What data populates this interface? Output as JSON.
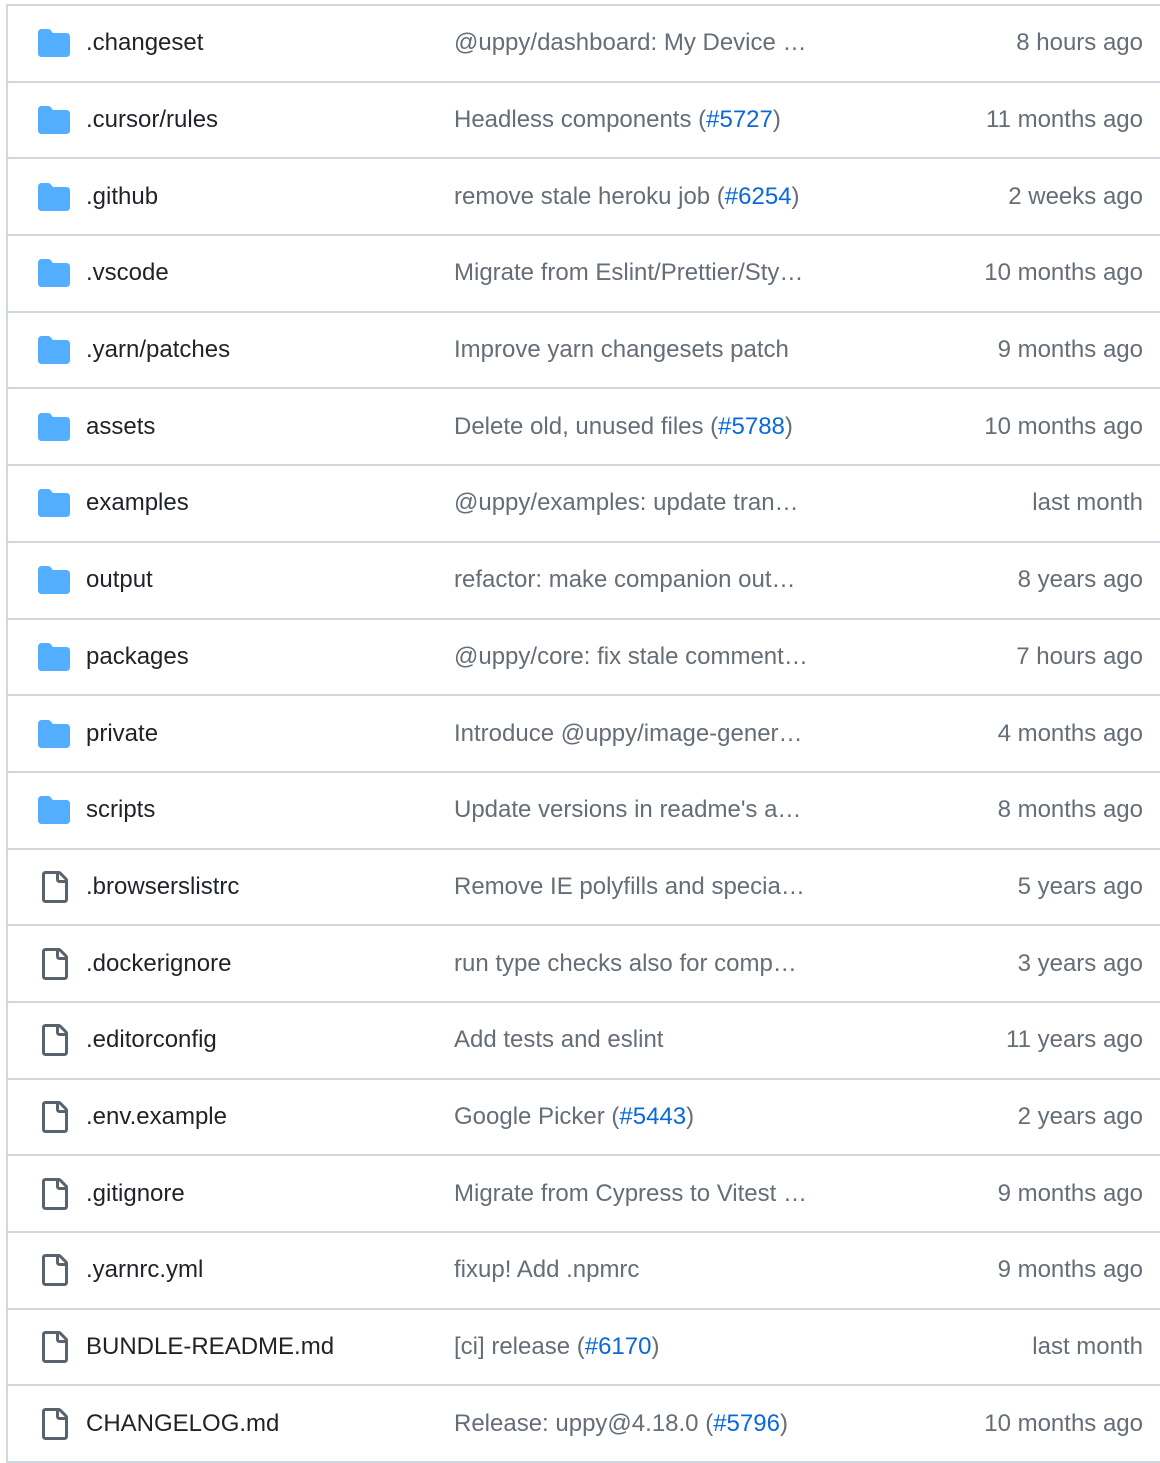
{
  "colors": {
    "folder": "#54aeff",
    "file_outline": "#59636e",
    "text": "#1f2328",
    "muted": "#656d76",
    "link": "#0969da",
    "border": "#d0d7de"
  },
  "files": [
    {
      "icon": "folder-icon",
      "name": ".changeset",
      "message": "@uppy/dashboard: My Device …",
      "pr": "",
      "message_end": "",
      "date": "8 hours ago"
    },
    {
      "icon": "folder-icon",
      "name": ".cursor/rules",
      "message": "Headless components (",
      "pr": "#5727",
      "message_end": ")",
      "date": "11 months ago"
    },
    {
      "icon": "folder-icon",
      "name": ".github",
      "message": "remove stale heroku job (",
      "pr": "#6254",
      "message_end": ")",
      "date": "2 weeks ago"
    },
    {
      "icon": "folder-icon",
      "name": ".vscode",
      "message": "Migrate from Eslint/Prettier/Sty…",
      "pr": "",
      "message_end": "",
      "date": "10 months ago"
    },
    {
      "icon": "folder-icon",
      "name": ".yarn/patches",
      "message": "Improve yarn changesets patch",
      "pr": "",
      "message_end": "",
      "date": "9 months ago"
    },
    {
      "icon": "folder-icon",
      "name": "assets",
      "message": "Delete old, unused files (",
      "pr": "#5788",
      "message_end": ")",
      "date": "10 months ago"
    },
    {
      "icon": "folder-icon",
      "name": "examples",
      "message": "@uppy/examples: update tran…",
      "pr": "",
      "message_end": "",
      "date": "last month"
    },
    {
      "icon": "folder-icon",
      "name": "output",
      "message": "refactor: make companion out…",
      "pr": "",
      "message_end": "",
      "date": "8 years ago"
    },
    {
      "icon": "folder-icon",
      "name": "packages",
      "message": "@uppy/core: fix stale comment…",
      "pr": "",
      "message_end": "",
      "date": "7 hours ago"
    },
    {
      "icon": "folder-icon",
      "name": "private",
      "message": "Introduce @uppy/image-gener…",
      "pr": "",
      "message_end": "",
      "date": "4 months ago"
    },
    {
      "icon": "folder-icon",
      "name": "scripts",
      "message": "Update versions in readme's a…",
      "pr": "",
      "message_end": "",
      "date": "8 months ago"
    },
    {
      "icon": "file-icon",
      "name": ".browserslistrc",
      "message": "Remove IE polyfills and specia…",
      "pr": "",
      "message_end": "",
      "date": "5 years ago"
    },
    {
      "icon": "file-icon",
      "name": ".dockerignore",
      "message": "run type checks also for comp…",
      "pr": "",
      "message_end": "",
      "date": "3 years ago"
    },
    {
      "icon": "file-icon",
      "name": ".editorconfig",
      "message": "Add tests and eslint",
      "pr": "",
      "message_end": "",
      "date": "11 years ago"
    },
    {
      "icon": "file-icon",
      "name": ".env.example",
      "message": "Google Picker (",
      "pr": "#5443",
      "message_end": ")",
      "date": "2 years ago"
    },
    {
      "icon": "file-icon",
      "name": ".gitignore",
      "message": "Migrate from Cypress to Vitest …",
      "pr": "",
      "message_end": "",
      "date": "9 months ago"
    },
    {
      "icon": "file-icon",
      "name": ".yarnrc.yml",
      "message": "fixup! Add .npmrc",
      "pr": "",
      "message_end": "",
      "date": "9 months ago"
    },
    {
      "icon": "file-icon",
      "name": "BUNDLE-README.md",
      "message": "[ci] release (",
      "pr": "#6170",
      "message_end": ")",
      "date": "last month"
    },
    {
      "icon": "file-icon",
      "name": "CHANGELOG.md",
      "message": "Release: uppy@4.18.0 (",
      "pr": "#5796",
      "message_end": ")",
      "date": "10 months ago"
    }
  ]
}
